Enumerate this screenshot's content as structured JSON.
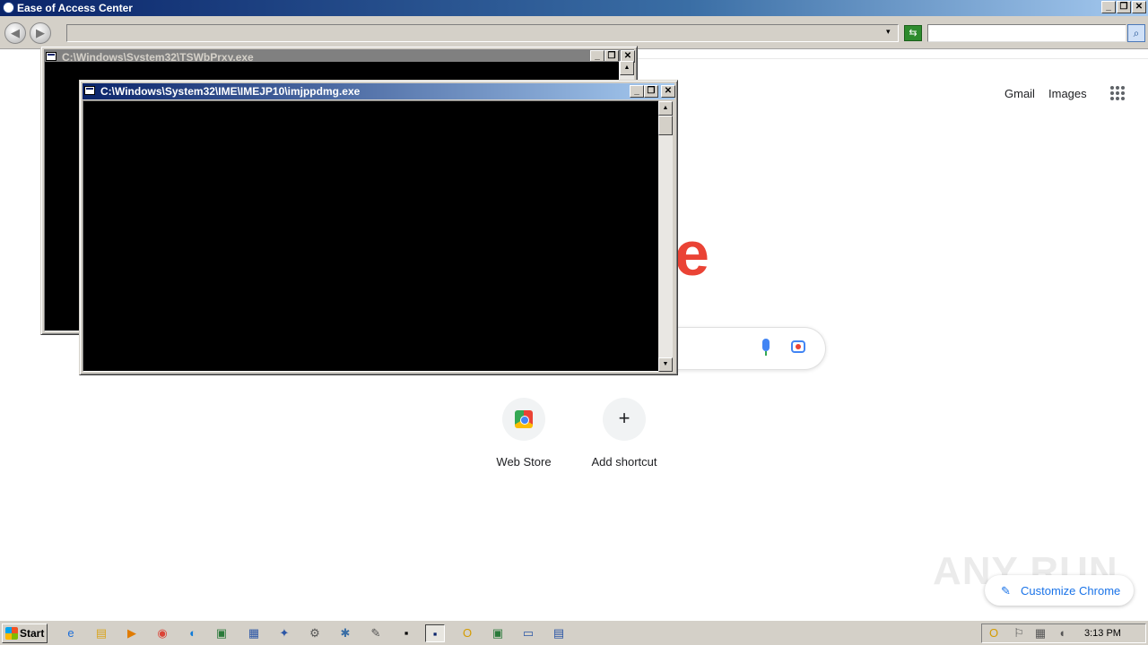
{
  "window": {
    "title": "Ease of Access Center",
    "minimize_glyph": "_",
    "maximize_glyph": "❐",
    "close_glyph": "✕"
  },
  "address_bar": {
    "back_glyph": "◀",
    "forward_glyph": "▶",
    "address_value": "",
    "dropdown_glyph": "▾",
    "refresh_glyph": "⇆",
    "search_value": "",
    "search_glyph": "⌕"
  },
  "chrome_page": {
    "links": {
      "gmail": "Gmail",
      "images": "Images"
    },
    "logo_fragment": "e",
    "shortcuts": [
      {
        "label": "Web Store"
      },
      {
        "label": "Add shortcut",
        "glyph": "+"
      }
    ],
    "customize_label": "Customize Chrome",
    "customize_glyph": "✎",
    "watermark": "ANY RUN"
  },
  "consoles": [
    {
      "title": "C:\\Windows\\System32\\TSWbPrxy.exe",
      "state": "inactive"
    },
    {
      "title": "C:\\Windows\\System32\\IME\\IMEJP10\\imjppdmg.exe",
      "state": "active"
    }
  ],
  "scrollbar": {
    "up_glyph": "▲",
    "down_glyph": "▼"
  },
  "taskbar": {
    "start_label": "Start",
    "icons": [
      "ie-icon",
      "explorer-icon",
      "media-player-icon",
      "chrome-icon",
      "edge-icon",
      "console-icon",
      "network-icon",
      "tool-icon",
      "app-icon",
      "settings-icon",
      "ease-icon",
      "cmd-icon",
      "active-console-icon",
      "outlook-icon",
      "console2-icon",
      "remote-icon",
      "app2-icon"
    ],
    "clock": "3:13 PM"
  },
  "colors": {
    "titlebar_active_start": "#0a246a",
    "titlebar_active_end": "#a6caf0",
    "titlebar_inactive": "#808080",
    "google_red": "#ea4335",
    "google_blue": "#1a73e8"
  }
}
